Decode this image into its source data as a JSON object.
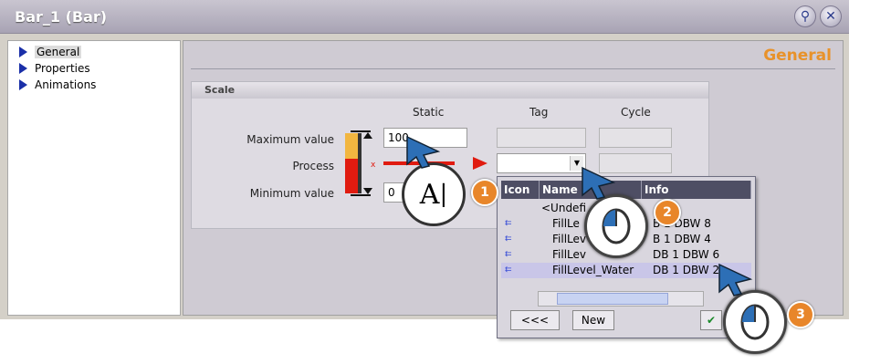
{
  "window": {
    "title": "Bar_1 (Bar)"
  },
  "nav": {
    "items": [
      {
        "label": "General"
      },
      {
        "label": "Properties"
      },
      {
        "label": "Animations"
      }
    ]
  },
  "main": {
    "header": "General"
  },
  "scale": {
    "title": "Scale",
    "columns": {
      "static": "Static",
      "tag": "Tag",
      "cycle": "Cycle"
    },
    "rows": {
      "max": {
        "label": "Maximum value",
        "static": "100"
      },
      "process": {
        "label": "Process"
      },
      "min": {
        "label": "Minimum value",
        "static": "0"
      }
    }
  },
  "tag_popup": {
    "headers": {
      "icon": "Icon",
      "name": "Name",
      "info": "Info"
    },
    "rows": [
      {
        "name": "<Undefi",
        "info": ""
      },
      {
        "name": "FillLe",
        "info": "B 1 DBW 8"
      },
      {
        "name": "FillLev",
        "info": "B 1 DBW 4"
      },
      {
        "name": "FillLev",
        "info": "DB 1 DBW 6"
      },
      {
        "name": "FillLevel_Water",
        "info": "DB 1 DBW 2"
      }
    ],
    "buttons": {
      "back": "<<<",
      "new": "New"
    }
  },
  "callouts": {
    "one": "1",
    "two": "2",
    "three": "3"
  },
  "colors": {
    "accent_header": "#e8922a",
    "callout": "#e8862a",
    "nav_arrow": "#1a2fa8"
  }
}
